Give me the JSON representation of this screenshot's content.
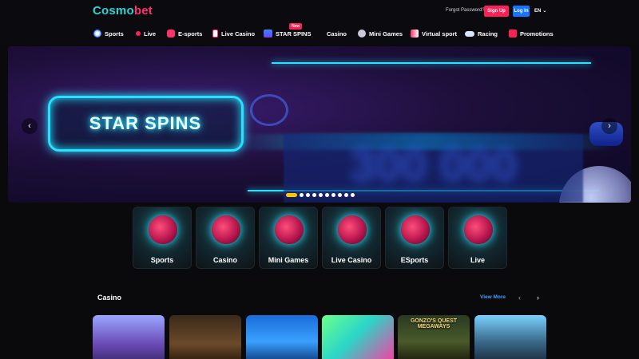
{
  "header": {
    "logo": {
      "part1": "Cosmo",
      "part2": "bet"
    },
    "forgot_password": "Forgot Password?",
    "sign_up": "Sign Up",
    "log_in": "Log In",
    "language": "EN"
  },
  "nav": {
    "items": [
      {
        "label": "Sports",
        "icon": "soccer-ball-icon"
      },
      {
        "label": "Live",
        "icon": "live-dot-icon"
      },
      {
        "label": "E-sports",
        "icon": "gamepad-icon"
      },
      {
        "label": "Live Casino",
        "icon": "card-icon"
      },
      {
        "label": "STAR SPINS",
        "icon": "slot-icon",
        "badge": "New"
      },
      {
        "label": "Casino",
        "icon": ""
      },
      {
        "label": "Mini Games",
        "icon": "joystick-icon"
      },
      {
        "label": "Virtual sport",
        "icon": "virtual-icon"
      },
      {
        "label": "Racing",
        "icon": "dog-icon"
      },
      {
        "label": "Promotions",
        "icon": "gift-icon"
      }
    ]
  },
  "banner": {
    "title": "STAR SPINS",
    "amount": "300 000",
    "slides_count": 10,
    "active_slide": 1
  },
  "categories": [
    {
      "label": "Sports"
    },
    {
      "label": "Casino"
    },
    {
      "label": "Mini Games"
    },
    {
      "label": "Live Casino"
    },
    {
      "label": "ESports"
    },
    {
      "label": "Live"
    }
  ],
  "casino": {
    "title": "Casino",
    "view_more": "View More",
    "games": [
      {
        "name": ""
      },
      {
        "name": ""
      },
      {
        "name": ""
      },
      {
        "name": ""
      },
      {
        "name": "GONZO'S QUEST MEGAWAYS"
      },
      {
        "name": ""
      }
    ]
  },
  "colors": {
    "brand_cyan": "#27d6d0",
    "brand_pink": "#ff2f6d",
    "signup": "#ff1f57",
    "login": "#1675ff",
    "accent_yellow": "#ffc400"
  }
}
